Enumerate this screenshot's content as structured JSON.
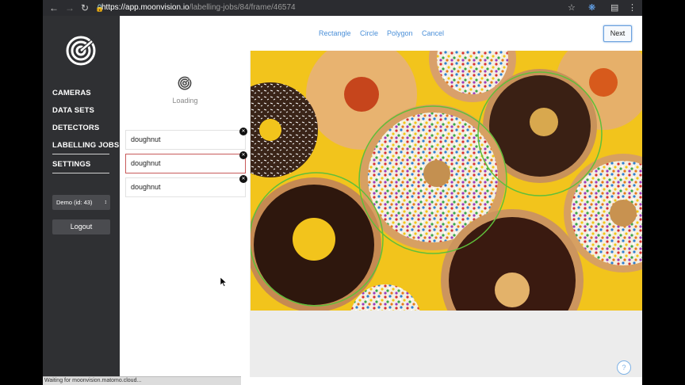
{
  "browser": {
    "url_host": "https://app.moonvision.io",
    "url_path": "/labelling-jobs/84/frame/46574"
  },
  "sidebar": {
    "menu": [
      {
        "label": "CAMERAS"
      },
      {
        "label": "DATA SETS"
      },
      {
        "label": "DETECTORS"
      },
      {
        "label": "LABELLING JOBS"
      }
    ],
    "settings_label": "SETTINGS",
    "workspace_select": "Demo (id: 43)",
    "logout_label": "Logout"
  },
  "toolbar": {
    "tools": [
      "Rectangle",
      "Circle",
      "Polygon",
      "Cancel"
    ],
    "next_label": "Next"
  },
  "panel": {
    "loading_text": "Loading",
    "labels": [
      "doughnut",
      "doughnut",
      "doughnut"
    ],
    "active_index": 1
  },
  "status_bar": "Waiting for moonvision.matomo.cloud...",
  "help_label": "?",
  "colors": {
    "sidebar_bg": "#2f3033",
    "accent": "#4a8fd8",
    "annotation": "#5fbf3a",
    "active_label_border": "#c85b5b"
  }
}
